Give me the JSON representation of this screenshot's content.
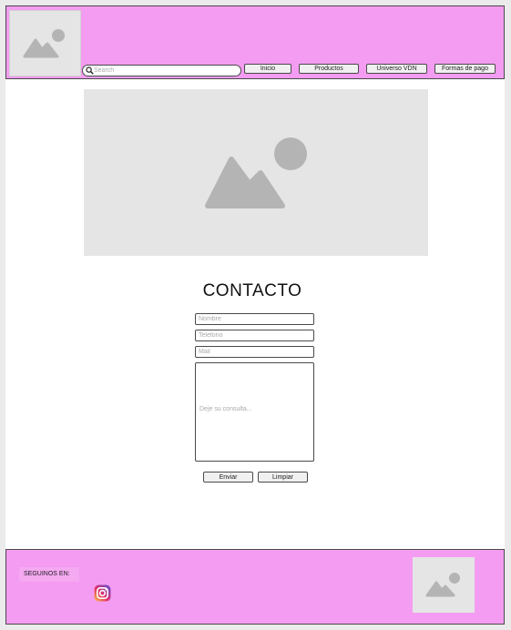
{
  "header": {
    "search": {
      "placeholder": "Search"
    },
    "nav": [
      {
        "label": "Inicio"
      },
      {
        "label": "Productos"
      },
      {
        "label": "Universo VDN"
      },
      {
        "label": "Formas de pago"
      }
    ],
    "logo_icon": "image-placeholder-icon"
  },
  "main": {
    "hero_icon": "image-placeholder-icon",
    "title": "CONTACTO",
    "form": {
      "name_placeholder": "Nombre",
      "phone_placeholder": "Telefono",
      "mail_placeholder": "Mail",
      "message_placeholder": "Deje su consulta...",
      "send_label": "Enviar",
      "clear_label": "Limpiar"
    }
  },
  "footer": {
    "follow_label": "SEGUINOS EN:",
    "social_icon": "instagram-icon",
    "logo_icon": "image-placeholder-icon"
  },
  "colors": {
    "header_footer_bg": "#f49cf1",
    "placeholder_gray": "#e5e5e5",
    "placeholder_icon": "#b4b4b4"
  }
}
